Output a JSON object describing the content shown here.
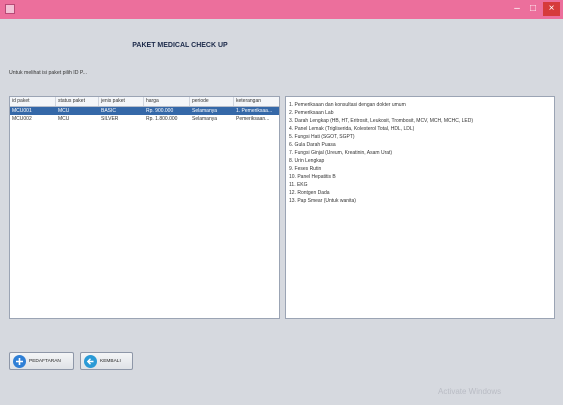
{
  "window": {
    "controls": {
      "minimize": "–",
      "maximize": "□",
      "close": "×"
    }
  },
  "page": {
    "title": "PAKET MEDICAL CHECK UP",
    "instruction": "Untuk melihat isi paket pilih ID P..."
  },
  "table": {
    "headers": [
      "id paket",
      "status paket",
      "jenis paket",
      "harga",
      "periode",
      "keterangan"
    ],
    "rows": [
      [
        "MCU001",
        "MCU",
        "BASIC",
        "Rp. 900.000",
        "Selamanya",
        "1. Pemeriksaa..."
      ],
      [
        "MCU002",
        "MCU",
        "SILVER",
        "Rp. 1.800.000",
        "Selamanya",
        "Pemeriksaan..."
      ]
    ],
    "selected_row": 0
  },
  "detail": {
    "lines": [
      "1. Pemeriksaan dan konsultasi dengan dokter umum",
      "2. Pemeriksaan Lab",
      "3. Darah Lengkap (HB, HT, Eritrosit, Leukosit, Trombosit, MCV, MCH, MCHC, LED)",
      "4. Panel Lemak (Trigliserida, Kolesterol Total, HDL, LDL)",
      "5. Fungsi Hati (SGOT, SGPT)",
      "6. Gula Darah Puasa",
      "7. Fungsi Ginjal (Ureum, Kreatinin, Asam Urat)",
      "8. Urin Lengkap",
      "9. Feses Rutin",
      "10. Panel Hepatitis B",
      "11. EKG",
      "12. Rontgen Dada",
      "13. Pap Smear (Untuk wanita)"
    ]
  },
  "buttons": {
    "daftar_label": "PEDAFTARAN",
    "kembali_label": "KEMBALI"
  },
  "watermark": "Activate Windows",
  "colors": {
    "titlebar": "#ec6f9c",
    "selection": "#3568a8",
    "background": "#d6d9df"
  }
}
